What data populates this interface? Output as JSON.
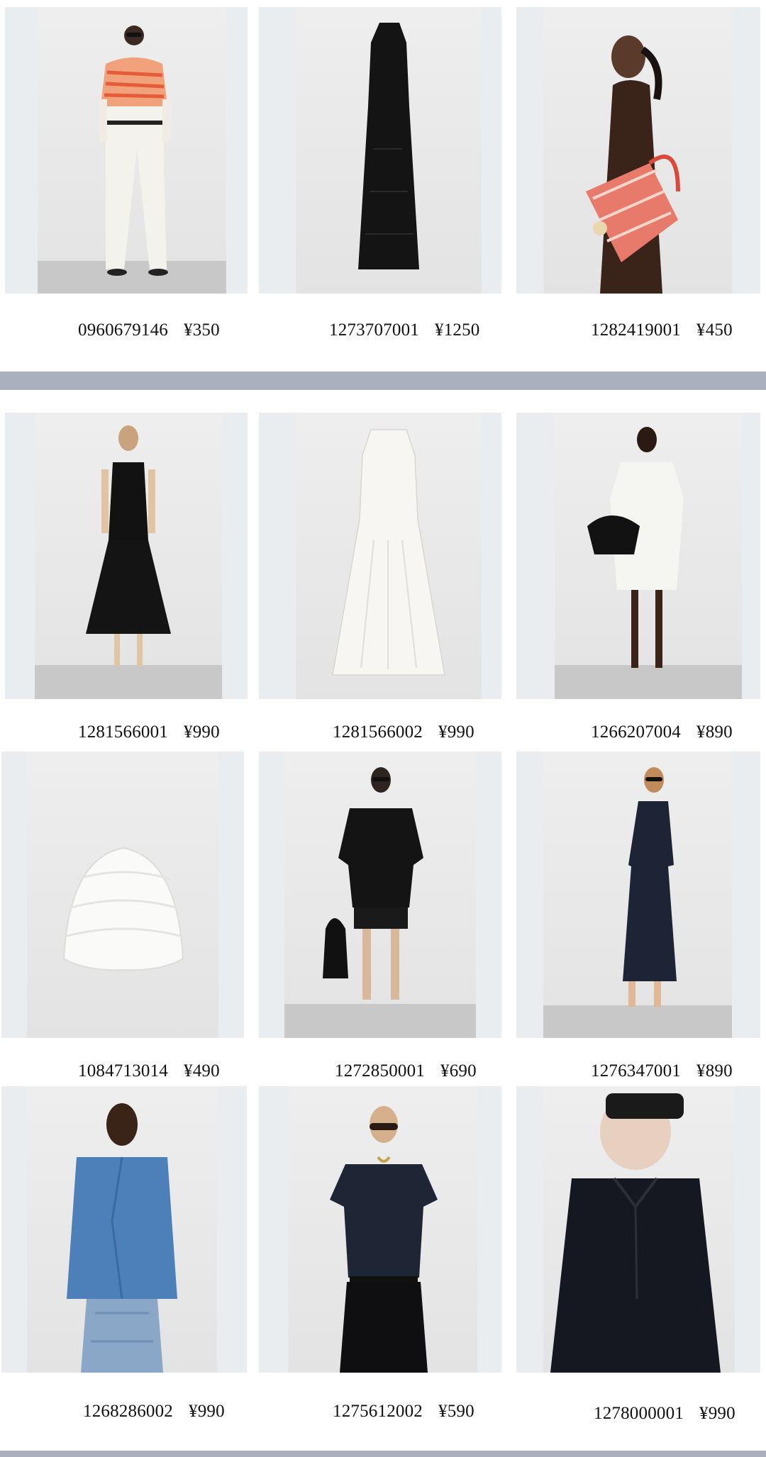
{
  "products": [
    {
      "id": "0960679146",
      "price": "¥350",
      "image": "model-striped-tee-white-jeans"
    },
    {
      "id": "1273707001",
      "price": "¥1250",
      "image": "black-sleeveless-maxi-dress"
    },
    {
      "id": "1282419001",
      "price": "¥450",
      "image": "model-profile-brown-dress-striped-tote"
    },
    {
      "id": "1281566001",
      "price": "¥990",
      "image": "model-black-drop-waist-dress"
    },
    {
      "id": "1281566002",
      "price": "¥990",
      "image": "white-sleeveless-dress"
    },
    {
      "id": "1266207004",
      "price": "¥890",
      "image": "model-white-tshirt-dress-black-bag"
    },
    {
      "id": "1084713014",
      "price": "¥490",
      "image": "white-crochet-bucket-hat"
    },
    {
      "id": "1272850001",
      "price": "¥690",
      "image": "model-black-shirt-shorts-tote"
    },
    {
      "id": "1276347001",
      "price": "¥890",
      "image": "model-navy-sleeveless-dress"
    },
    {
      "id": "1268286002",
      "price": "¥990",
      "image": "model-blue-shirt-jeans"
    },
    {
      "id": "1275612002",
      "price": "¥590",
      "image": "model-navy-vneck-top"
    },
    {
      "id": "1278000001",
      "price": "¥990",
      "image": "model-black-polo-sunglasses"
    }
  ],
  "colors": {
    "card_bg": "#e9edf0",
    "divider": "#aab0bd",
    "text": "#111111"
  }
}
